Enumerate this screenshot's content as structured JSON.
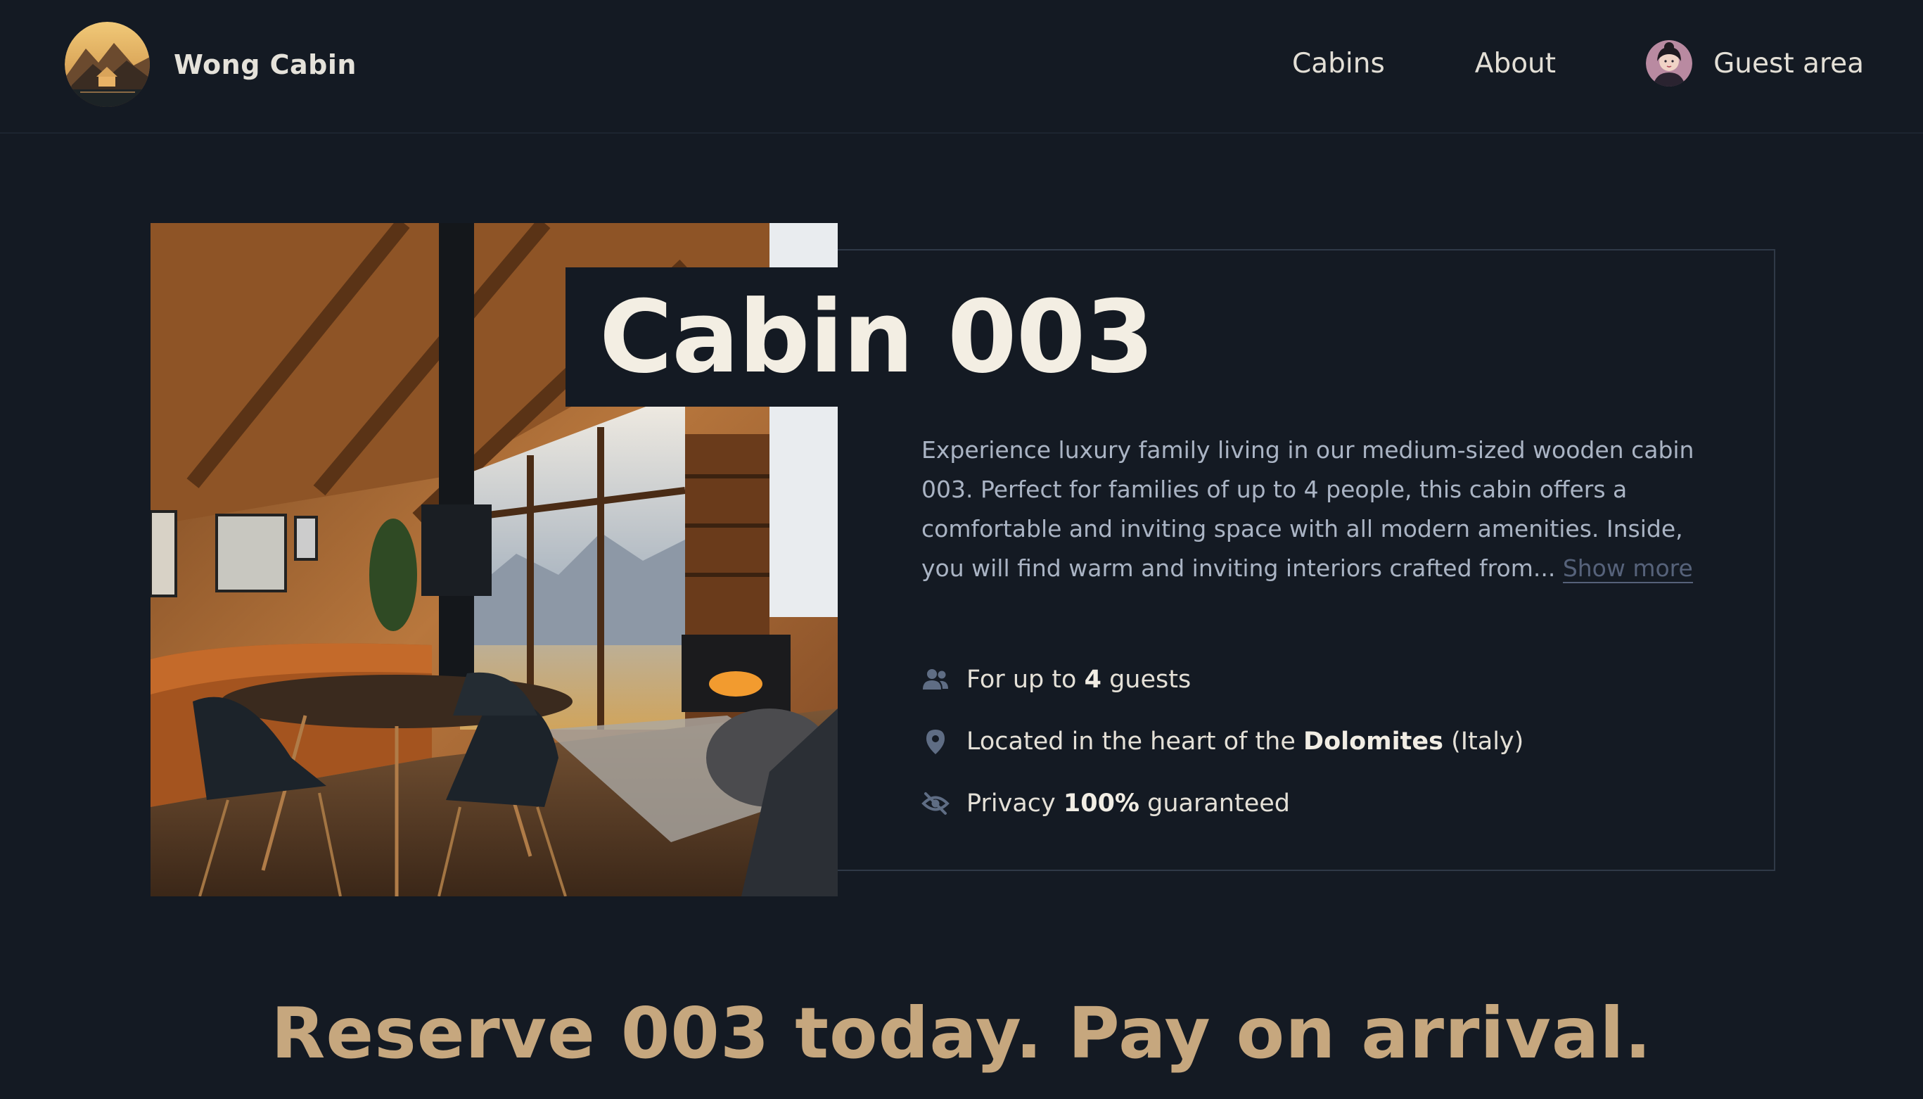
{
  "header": {
    "logo_icon": "cabin-mountain-logo",
    "brand": "Wong Cabin",
    "nav": {
      "cabins": "Cabins",
      "about": "About",
      "guest_area": "Guest area",
      "avatar_icon": "user-avatar"
    }
  },
  "cabin": {
    "photo_icon": "cabin-interior-photo",
    "title": "Cabin 003",
    "description": "Experience luxury family living in our medium-sized wooden cabin 003. Perfect for families of up to 4 people, this cabin offers a comfortable and inviting space with all modern amenities. Inside, you will find warm and inviting interiors crafted from...",
    "show_more": "Show more",
    "features": [
      {
        "icon": "users-icon",
        "pre": "For up to ",
        "bold": "4",
        "post": " guests"
      },
      {
        "icon": "map-pin-icon",
        "pre": "Located in the heart of the ",
        "bold": "Dolomites",
        "post": " (Italy)"
      },
      {
        "icon": "eye-slash-icon",
        "pre": "Privacy ",
        "bold": "100%",
        "post": " guaranteed"
      }
    ]
  },
  "reserve": {
    "heading": "Reserve 003 today. Pay on arrival."
  },
  "colors": {
    "background": "#141a23",
    "accent": "#c6a77e",
    "border": "#2f3947",
    "icon": "#5f6d84"
  }
}
